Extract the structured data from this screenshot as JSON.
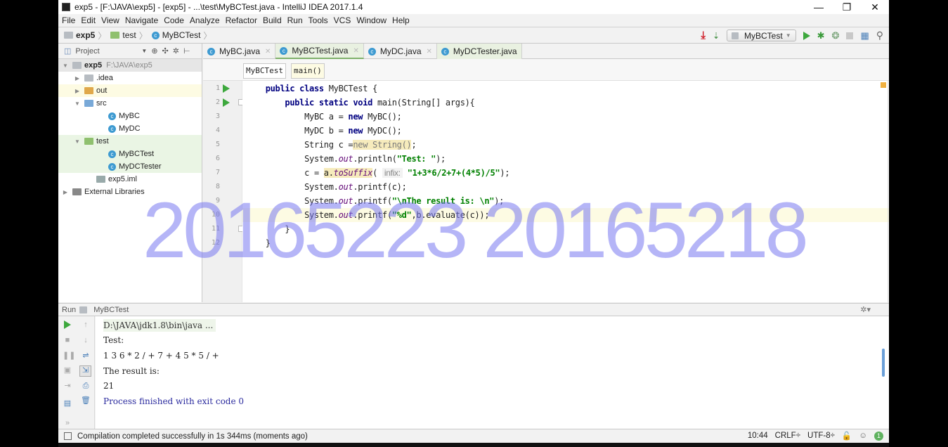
{
  "window": {
    "title": "exp5 - [F:\\JAVA\\exp5] - [exp5] - ...\\test\\MyBCTest.java - IntelliJ IDEA 2017.1.4",
    "minimize": "—",
    "restore": "❐",
    "close": "✕"
  },
  "menu": [
    "File",
    "Edit",
    "View",
    "Navigate",
    "Code",
    "Analyze",
    "Refactor",
    "Build",
    "Run",
    "Tools",
    "VCS",
    "Window",
    "Help"
  ],
  "breadcrumb": [
    "exp5",
    "test",
    "MyBCTest"
  ],
  "run_config": "MyBCTest",
  "project": {
    "header": "Project",
    "tree": [
      {
        "label": "exp5",
        "extra": "F:\\JAVA\\exp5",
        "arrow": "▼",
        "indent": 0,
        "icon": "module",
        "bold": true
      },
      {
        "label": ".idea",
        "arrow": "▶",
        "indent": 1,
        "icon": "folder"
      },
      {
        "label": "out",
        "arrow": "▶",
        "indent": 1,
        "icon": "folder-orange"
      },
      {
        "label": "src",
        "arrow": "▼",
        "indent": 1,
        "icon": "folder-blue"
      },
      {
        "label": "MyBC",
        "indent": 3,
        "icon": "class"
      },
      {
        "label": "MyDC",
        "indent": 3,
        "icon": "class"
      },
      {
        "label": "test",
        "arrow": "▼",
        "indent": 1,
        "icon": "folder-green"
      },
      {
        "label": "MyBCTest",
        "indent": 3,
        "icon": "class-run"
      },
      {
        "label": "MyDCTester",
        "indent": 3,
        "icon": "class-run"
      },
      {
        "label": "exp5.iml",
        "indent": 2,
        "icon": "file"
      },
      {
        "label": "External Libraries",
        "arrow": "▶",
        "indent": 0,
        "icon": "library"
      }
    ]
  },
  "tabs": [
    {
      "label": "MyBC.java"
    },
    {
      "label": "MyBCTest.java",
      "active": true
    },
    {
      "label": "MyDC.java"
    },
    {
      "label": "MyDCTester.java"
    }
  ],
  "editor_breadcrumb": [
    "MyBCTest",
    "main()"
  ],
  "code": [
    [
      [
        "    ",
        ""
      ],
      [
        "public class ",
        "k"
      ],
      [
        "MyBCTest {",
        ""
      ]
    ],
    [
      [
        "        ",
        ""
      ],
      [
        "public static void ",
        "k"
      ],
      [
        "main(String[] args){",
        ""
      ]
    ],
    [
      [
        "            MyBC a = ",
        ""
      ],
      [
        "new ",
        "k"
      ],
      [
        "MyBC();",
        ""
      ]
    ],
    [
      [
        "            MyDC b = ",
        ""
      ],
      [
        "new ",
        "k"
      ],
      [
        "MyDC();",
        ""
      ]
    ],
    [
      [
        "            String c =",
        ""
      ],
      [
        "new String()",
        "warn"
      ],
      [
        ";",
        ""
      ]
    ],
    [
      [
        "            System.",
        ""
      ],
      [
        "out",
        "f"
      ],
      [
        ".println(",
        ""
      ],
      [
        "\"Test: \"",
        "s"
      ],
      [
        ");",
        ""
      ]
    ],
    [
      [
        "            c = ",
        ""
      ],
      [
        "a.",
        "hl"
      ],
      [
        "toSuffix",
        "f hl"
      ],
      [
        "( ",
        ""
      ],
      [
        "infix:",
        "hint"
      ],
      [
        " ",
        ""
      ],
      [
        "\"1+3*6/2+7+(4*5)/5\"",
        "s"
      ],
      [
        ");",
        ""
      ]
    ],
    [
      [
        "            System.",
        ""
      ],
      [
        "out",
        "f"
      ],
      [
        ".printf(c);",
        ""
      ]
    ],
    [
      [
        "            System.",
        ""
      ],
      [
        "out",
        "f"
      ],
      [
        ".printf(",
        ""
      ],
      [
        "\"\\nThe result is: \\n\"",
        "s"
      ],
      [
        ");",
        ""
      ]
    ],
    [
      [
        "            System.",
        ""
      ],
      [
        "out",
        "f"
      ],
      [
        ".printf(",
        ""
      ],
      [
        "\"%d\"",
        "s"
      ],
      [
        ",b.evaluate(c));",
        ""
      ]
    ],
    [
      [
        "        }",
        ""
      ]
    ],
    [
      [
        "    }",
        ""
      ]
    ]
  ],
  "run_panel": {
    "label": "Run",
    "config": "MyBCTest",
    "output": [
      "D:\\JAVA\\jdk1.8\\bin\\java ...",
      "Test:",
      "1 3 6 * 2 / + 7 + 4 5 * 5 / +",
      "The result is:",
      "21",
      "Process finished with exit code 0"
    ]
  },
  "watermark": "20165223 20165218",
  "status": {
    "message": "Compilation completed successfully in 1s 344ms (moments ago)",
    "position": "10:44",
    "line_sep": "CRLF÷",
    "encoding": "UTF-8÷",
    "notifications": "1"
  }
}
